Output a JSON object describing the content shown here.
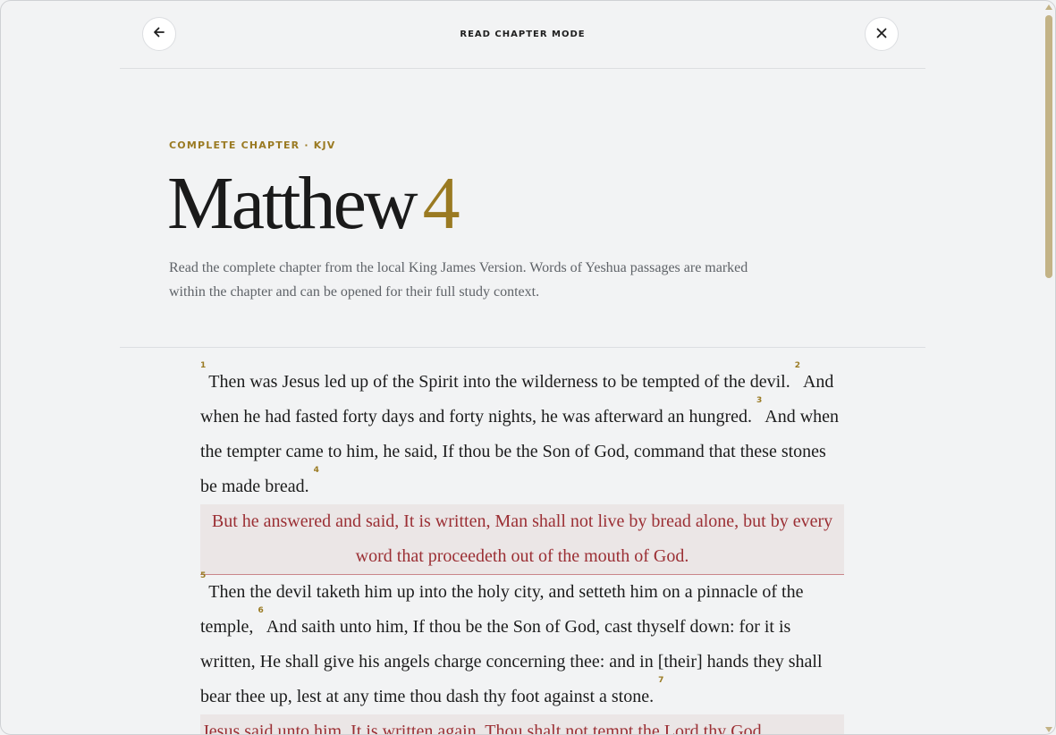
{
  "header": {
    "mode_title": "READ CHAPTER MODE",
    "back_icon": "arrow-left-icon",
    "close_icon": "close-icon"
  },
  "chapter": {
    "eyebrow": "COMPLETE CHAPTER · KJV",
    "book": "Matthew",
    "number": "4",
    "intro": "Read the complete chapter from the local King James Version. Words of Yeshua passages are marked within the chapter and can be opened for their full study context."
  },
  "verses": {
    "v1_num": "1",
    "v1_text": "Then was Jesus led up of the Spirit into the wilderness to be tempted of the devil.",
    "v2_num": "2",
    "v2_text": "And when he had fasted forty days and forty nights, he was afterward an hungred.",
    "v3_num": "3",
    "v3_text": "And when the tempter came to him, he said, If thou be the Son of God, command that these stones be made bread.",
    "v4_num": "4",
    "v4_words": "But he answered and said, It is written, Man shall not live by bread alone, but by every word that proceedeth out of the mouth of God.",
    "v5_num": "5",
    "v5_text": "Then the devil taketh him up into the holy city, and setteth him on a pinnacle of the temple,",
    "v6_num": "6",
    "v6_text": "And saith unto him, If thou be the Son of God, cast thyself down: for it is written, He shall give his angels charge concerning thee: and in [their] hands they shall bear thee up, lest at any time thou dash thy foot against a stone.",
    "v7_num": "7",
    "v7_words": "Jesus said unto him, It is written again, Thou shalt not tempt the Lord thy God."
  },
  "colors": {
    "accent": "#9a7a22",
    "red_letter": "#9b2f34",
    "red_letter_bg": "#ebe6e6",
    "background": "#f2f3f4"
  }
}
